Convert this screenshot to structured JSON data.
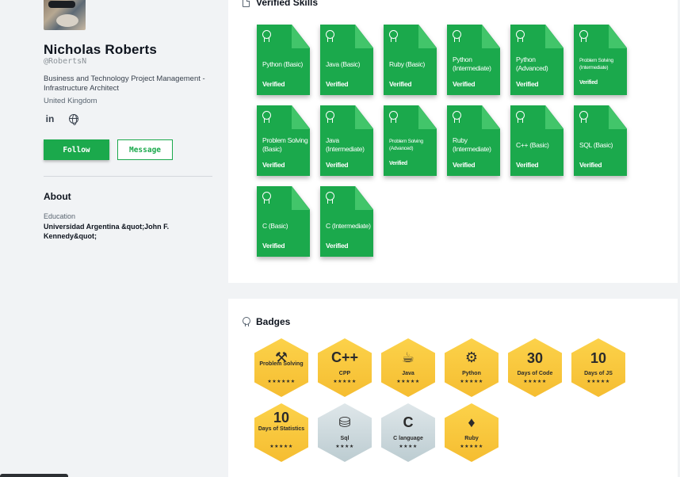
{
  "profile": {
    "name": "Nicholas Roberts",
    "handle": "@RobertsN",
    "title": "Business and Technology Project Management - Infrastructure Architect",
    "location": "United Kingdom",
    "social": {
      "linkedin_icon": "linkedin-icon",
      "linkedin_label": "in",
      "website_icon": "globe-icon"
    },
    "follow_label": "Follow",
    "message_label": "Message"
  },
  "about": {
    "title": "About",
    "education_label": "Education",
    "education_value": "Universidad Argentina &quot;John F. Kennedy&quot;"
  },
  "skills": {
    "title": "Verified Skills",
    "icon": "document-icon",
    "items": [
      {
        "name": "Python (Basic)",
        "status": "Verified"
      },
      {
        "name": "Java (Basic)",
        "status": "Verified"
      },
      {
        "name": "Ruby (Basic)",
        "status": "Verified"
      },
      {
        "name": "Python (Intermediate)",
        "status": "Verified"
      },
      {
        "name": "Python (Advanced)",
        "status": "Verified"
      },
      {
        "name": "Problem Solving (Intermediate)",
        "status": "Verified"
      },
      {
        "name": "Problem Solving (Basic)",
        "status": "Verified"
      },
      {
        "name": "Java (Intermediate)",
        "status": "Verified"
      },
      {
        "name": "Problem Solving (Advanced)",
        "status": "Verified"
      },
      {
        "name": "Ruby (Intermediate)",
        "status": "Verified"
      },
      {
        "name": "C++ (Basic)",
        "status": "Verified"
      },
      {
        "name": "SQL (Basic)",
        "status": "Verified"
      },
      {
        "name": "C (Basic)",
        "status": "Verified"
      },
      {
        "name": "C (Intermediate)",
        "status": "Verified"
      }
    ]
  },
  "badges": {
    "title": "Badges",
    "icon": "ribbon-icon",
    "items": [
      {
        "label": "Problem Solving",
        "symbol": "⚒",
        "stars": "★★★★★★",
        "tier": "gold"
      },
      {
        "label": "CPP",
        "symbol": "C++",
        "stars": "★★★★★",
        "tier": "gold"
      },
      {
        "label": "Java",
        "symbol": "☕",
        "stars": "★★★★★",
        "tier": "gold"
      },
      {
        "label": "Python",
        "symbol": "⚙",
        "stars": "★★★★★",
        "tier": "gold"
      },
      {
        "label": "Days of Code",
        "number": "30",
        "stars": "★★★★★",
        "tier": "gold"
      },
      {
        "label": "Days of JS",
        "number": "10",
        "stars": "★★★★★",
        "tier": "gold"
      },
      {
        "label": "Days of Statistics",
        "number": "10",
        "stars": "★★★★★",
        "tier": "gold"
      },
      {
        "label": "Sql",
        "symbol": "⛁",
        "stars": "★★★★",
        "tier": "silver"
      },
      {
        "label": "C language",
        "symbol": "C",
        "stars": "★★★★",
        "tier": "silver"
      },
      {
        "label": "Ruby",
        "symbol": "♦",
        "stars": "★★★★★",
        "tier": "gold"
      }
    ]
  },
  "colors": {
    "accent": "#1ba94c",
    "gold": "#f5bd31",
    "silver": "#bcccd1"
  }
}
